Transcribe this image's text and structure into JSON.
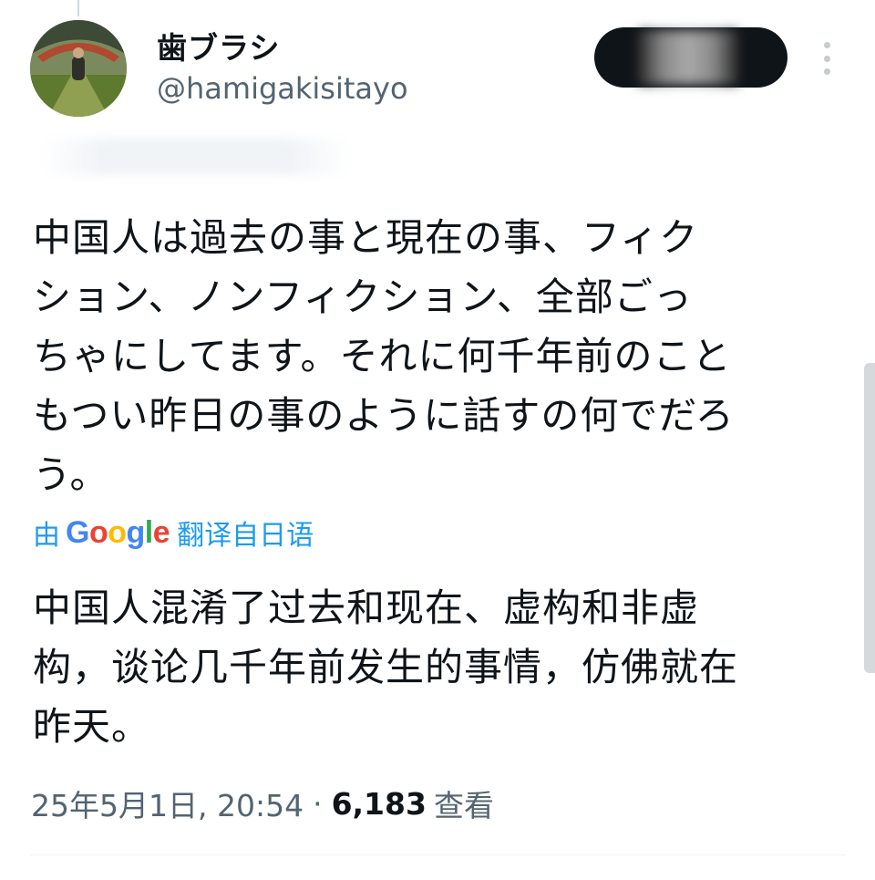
{
  "user": {
    "display_name": "歯ブラシ",
    "handle": "@hamigakisitayo"
  },
  "tweet": {
    "text": "中国人は過去の事と現在の事、フィク\nション、ノンフィクション、全部ごっ\nちゃにしてます。それに何千年前のこと\nもつい昨日の事のように話すの何でだろ\nう。",
    "translation_prefix": "由",
    "translation_brand": [
      "G",
      "o",
      "o",
      "g",
      "l",
      "e"
    ],
    "translation_suffix": "翻译自日语",
    "translated_text": "中国人混淆了过去和现在、虚构和非虚\n构，谈论几千年前发生的事情，仿佛就在\n昨天。"
  },
  "meta": {
    "timestamp": "25年5月1日, 20:54",
    "separator": "·",
    "view_count": "6,183",
    "view_label": "查看"
  },
  "icons": {
    "more": "more-vertical-icon"
  },
  "colors": {
    "link_blue": "#1d9bf0",
    "text_primary": "#0f1419",
    "text_secondary": "#536471",
    "google_blue": "#4285f4",
    "google_red": "#ea4335",
    "google_yellow": "#fbbc05",
    "google_green": "#34a853"
  }
}
